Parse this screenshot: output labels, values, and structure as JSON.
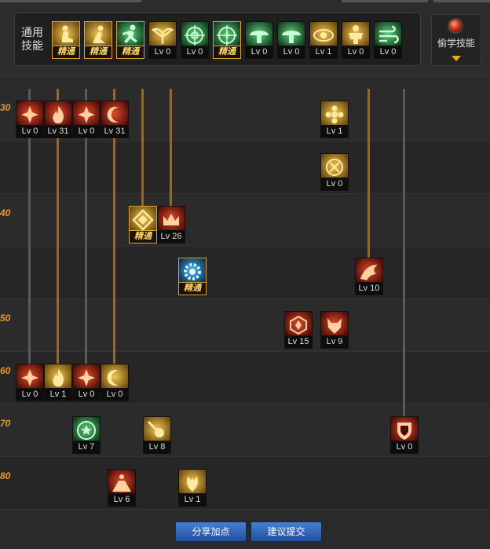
{
  "colors": {
    "accent": "#e39a2a",
    "master": "#d8a23c",
    "panel": "#1f1f1f",
    "button": "#2f64b8"
  },
  "common": {
    "label": "通用\n技能",
    "skills": [
      {
        "lv": "精通",
        "master": true,
        "icon": "sit-icon",
        "theme": "gold"
      },
      {
        "lv": "精通",
        "master": true,
        "icon": "crouch-icon",
        "theme": "gold"
      },
      {
        "lv": "精通",
        "master": true,
        "icon": "run-icon",
        "theme": "green"
      },
      {
        "lv": "Lv 0",
        "master": false,
        "icon": "wings-icon",
        "theme": "gold"
      },
      {
        "lv": "Lv 0",
        "master": false,
        "icon": "crosshair-icon",
        "theme": "green"
      },
      {
        "lv": "精通",
        "master": true,
        "icon": "crosshair-star-icon",
        "theme": "green"
      },
      {
        "lv": "Lv 0",
        "master": false,
        "icon": "mushroom-icon",
        "theme": "green"
      },
      {
        "lv": "Lv 0",
        "master": false,
        "icon": "mushroom-icon",
        "theme": "green"
      },
      {
        "lv": "Lv 1",
        "master": false,
        "icon": "eye-icon",
        "theme": "gold"
      },
      {
        "lv": "Lv 0",
        "master": false,
        "icon": "muscle-icon",
        "theme": "gold"
      },
      {
        "lv": "Lv 0",
        "master": false,
        "icon": "wind-icon",
        "theme": "green"
      }
    ]
  },
  "stealth": {
    "label": "偷学技能"
  },
  "levels": [
    "30",
    "40",
    "50",
    "60",
    "70",
    "80"
  ],
  "tree": [
    {
      "lv": "Lv 0",
      "master": false,
      "icon": "sparkle-icon",
      "theme": "red"
    },
    {
      "lv": "Lv 31",
      "master": false,
      "icon": "flame-icon",
      "theme": "red"
    },
    {
      "lv": "Lv 0",
      "master": false,
      "icon": "sparkle-icon",
      "theme": "red"
    },
    {
      "lv": "Lv 31",
      "master": false,
      "icon": "crescent-icon",
      "theme": "red"
    },
    {
      "lv": "Lv 1",
      "master": false,
      "icon": "flower-icon",
      "theme": "gold"
    },
    {
      "lv": "Lv 0",
      "master": false,
      "icon": "rune-icon",
      "theme": "gold"
    },
    {
      "lv": "精通",
      "master": true,
      "icon": "diamond-icon",
      "theme": "gold"
    },
    {
      "lv": "Lv 26",
      "master": false,
      "icon": "crown-icon",
      "theme": "red"
    },
    {
      "lv": "精通",
      "master": true,
      "icon": "gear-icon",
      "theme": "blue"
    },
    {
      "lv": "Lv 10",
      "master": false,
      "icon": "dragon-icon",
      "theme": "red"
    },
    {
      "lv": "Lv 15",
      "master": false,
      "icon": "emblem-icon",
      "theme": "red"
    },
    {
      "lv": "Lv 9",
      "master": false,
      "icon": "demon-icon",
      "theme": "red"
    },
    {
      "lv": "Lv 0",
      "master": false,
      "icon": "sparkle-icon",
      "theme": "red"
    },
    {
      "lv": "Lv 1",
      "master": false,
      "icon": "flame-icon",
      "theme": "gold"
    },
    {
      "lv": "Lv 0",
      "master": false,
      "icon": "sparkle-icon",
      "theme": "red"
    },
    {
      "lv": "Lv 0",
      "master": false,
      "icon": "crescent-icon",
      "theme": "gold"
    },
    {
      "lv": "Lv 7",
      "master": false,
      "icon": "star-moon-icon",
      "theme": "green"
    },
    {
      "lv": "Lv 8",
      "master": false,
      "icon": "meteor-icon",
      "theme": "gold"
    },
    {
      "lv": "Lv 0",
      "master": false,
      "icon": "shield-icon",
      "theme": "red"
    },
    {
      "lv": "Lv 6",
      "master": false,
      "icon": "volcano-icon",
      "theme": "red"
    },
    {
      "lv": "Lv 1",
      "master": false,
      "icon": "phoenix-icon",
      "theme": "gold"
    }
  ],
  "buttons": {
    "share": "分享加点",
    "submit": "建议提交"
  }
}
